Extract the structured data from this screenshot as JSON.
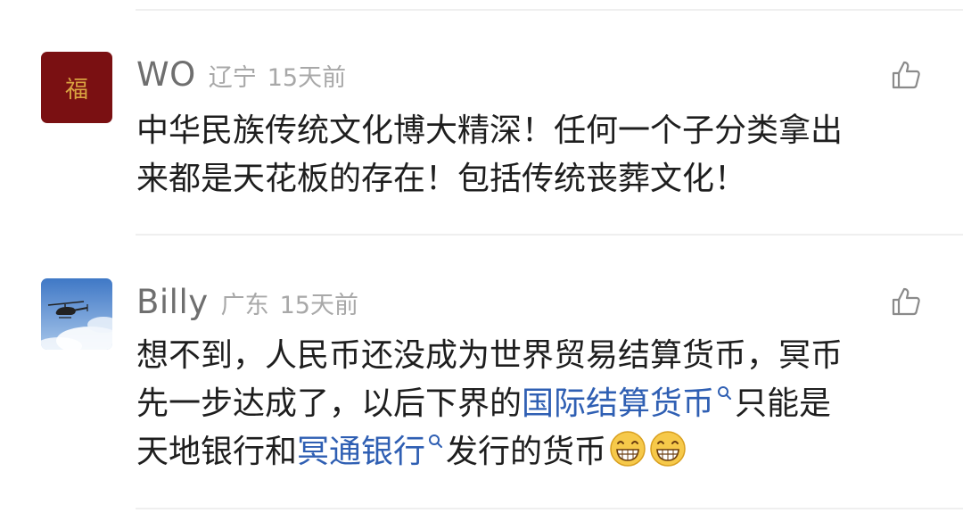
{
  "comments": [
    {
      "username": "WO",
      "location": "辽宁",
      "time": "15天前",
      "avatar_label": "福",
      "avatar_icon": "fu-character-icon",
      "like_icon": "thumbs-up-icon",
      "lines": [
        "中华民族传统文化博大精深！任何一个子分类拿出",
        "来都是天花板的存在！包括传统丧葬文化！"
      ]
    },
    {
      "username": "Billy",
      "location": "广东",
      "time": "15天前",
      "avatar_icon": "helicopter-photo-icon",
      "like_icon": "thumbs-up-icon",
      "line1": "想不到，人民币还没成为世界贸易结算货币，冥币",
      "line2_prefix": "先一步达成了，以后下界的",
      "link1": "国际结算货币",
      "line2_suffix": "只能是",
      "line3_prefix": "天地银行和",
      "link2": "冥通银行",
      "line3_suffix": "发行的货币",
      "emoji_icon": "grinning-face-emoji",
      "emoji_count": 2
    }
  ],
  "colors": {
    "username": "#6f6f6f",
    "meta": "#a8a8a8",
    "text": "#1e1e1e",
    "link": "#2f5fb3",
    "avatar_red": "#7a1012"
  }
}
